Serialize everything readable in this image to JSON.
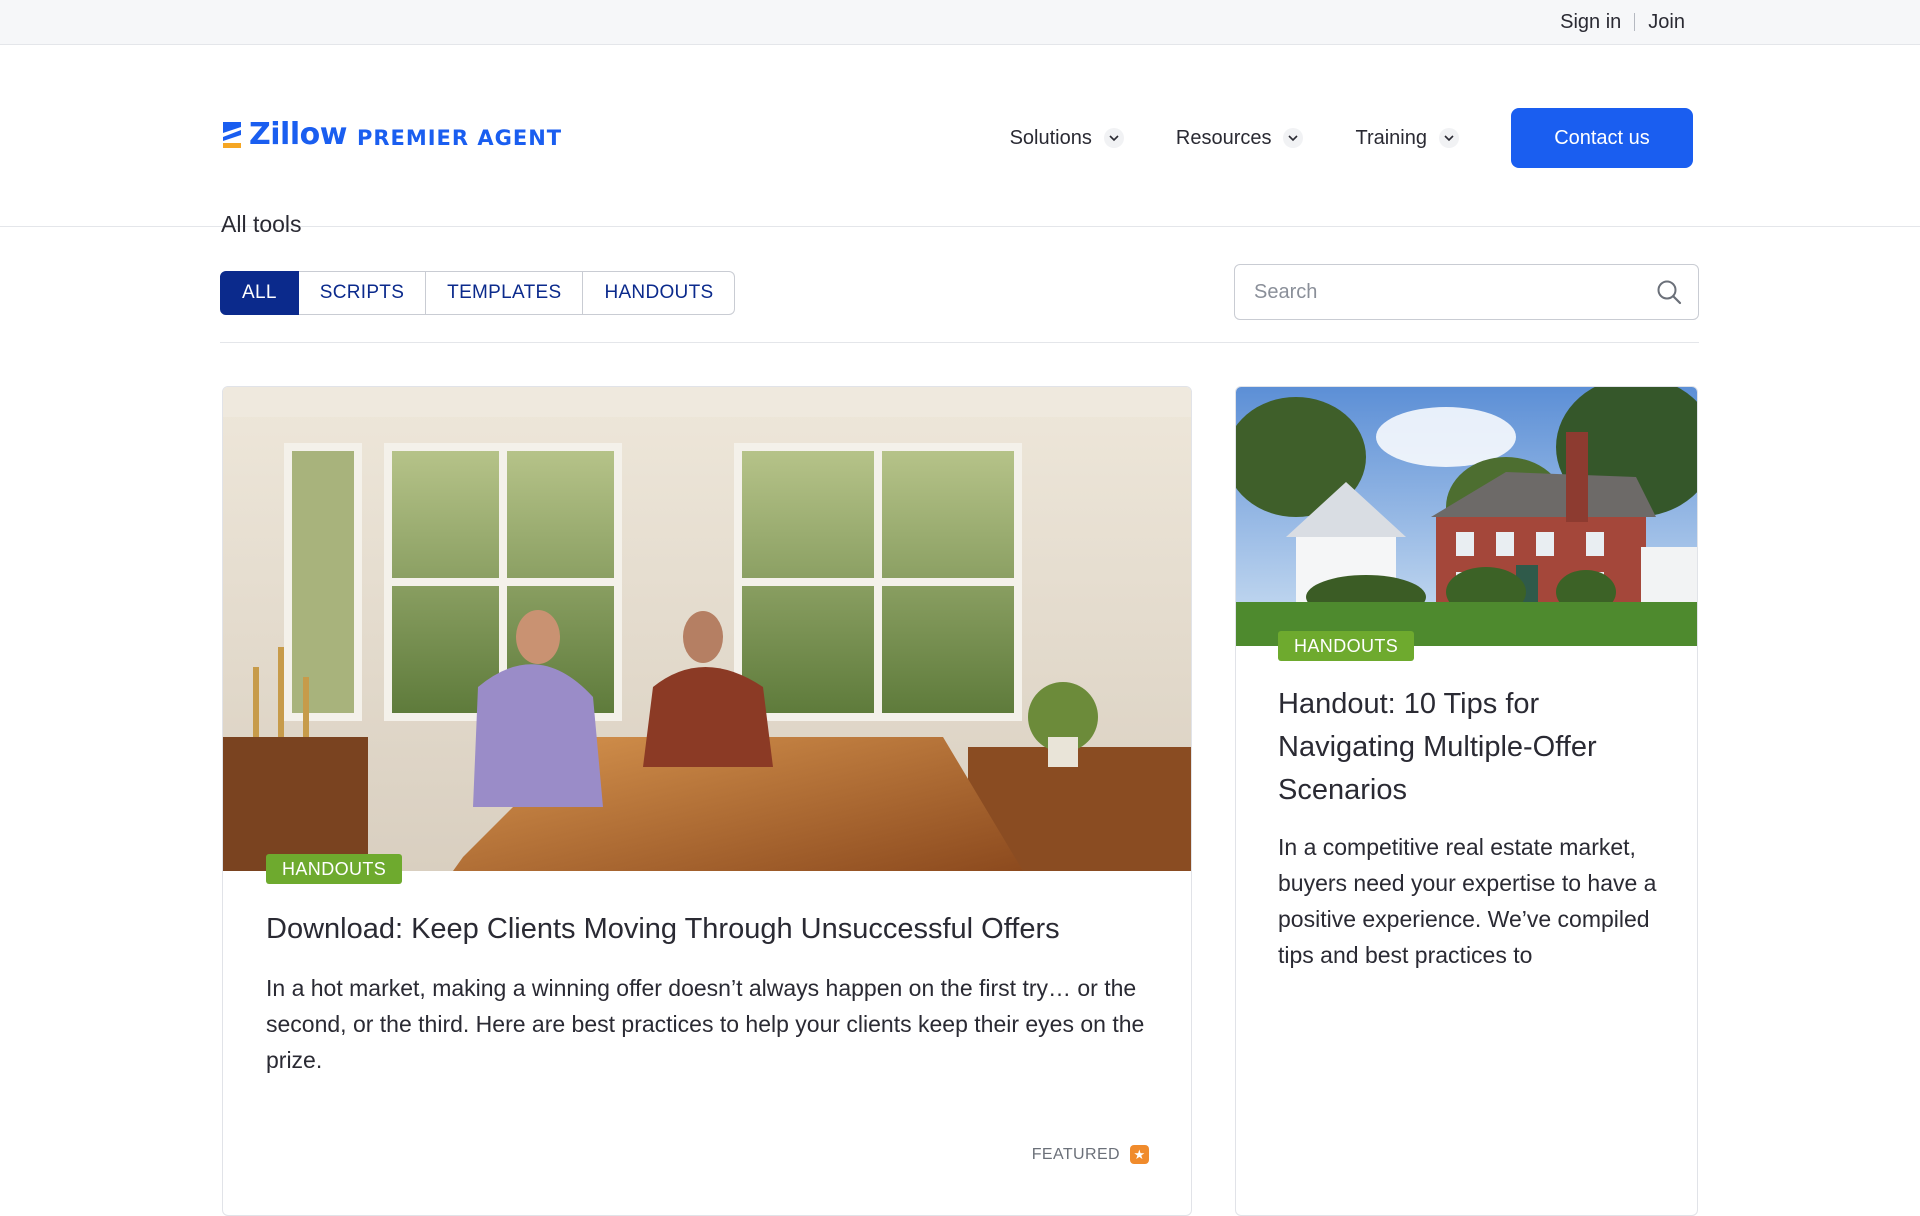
{
  "utility": {
    "sign_in": "Sign in",
    "join": "Join"
  },
  "brand": {
    "word": "Zillow",
    "sub": "PREMIER AGENT",
    "color": "#1a5ef0"
  },
  "nav": {
    "items": [
      {
        "label": "Solutions"
      },
      {
        "label": "Resources"
      },
      {
        "label": "Training"
      }
    ],
    "contact_label": "Contact us"
  },
  "breadcrumb": "All tools",
  "filters": {
    "tabs": [
      {
        "label": "ALL",
        "active": true
      },
      {
        "label": "SCRIPTS",
        "active": false
      },
      {
        "label": "TEMPLATES",
        "active": false
      },
      {
        "label": "HANDOUTS",
        "active": false
      }
    ],
    "search_placeholder": "Search"
  },
  "cards": [
    {
      "badge": "HANDOUTS",
      "title": "Download: Keep Clients Moving Through Unsuccessful Offers",
      "description": "In a hot market, making a winning offer doesn’t always happen on the first try… or the second, or the third. Here are best practices to help your clients keep their eyes on the prize.",
      "featured_label": "FEATURED",
      "image_icon": "dining-room-photo"
    },
    {
      "badge": "HANDOUTS",
      "title": "Handout: 10 Tips for Navigating Multiple-Offer Scenarios",
      "description": "In a competitive real estate market, buyers need your expertise to have a positive experience. We’ve compiled tips and best practices to",
      "image_icon": "brick-house-photo"
    }
  ],
  "colors": {
    "accent": "#1a5ef0",
    "tab_active": "#0b2a8c",
    "badge": "#6eaa2e",
    "featured_star": "#f08b2c"
  }
}
